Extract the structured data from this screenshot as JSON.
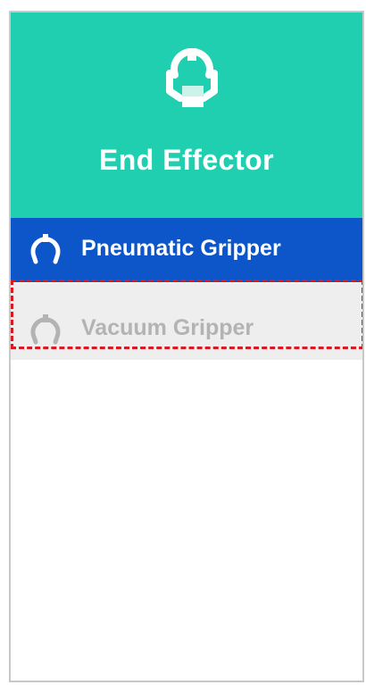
{
  "header": {
    "title": "End Effector",
    "icon": "end-effector-icon",
    "background_color": "#1fcfb0"
  },
  "menu": {
    "items": [
      {
        "label": "Pneumatic Gripper",
        "icon": "gripper-icon",
        "state": "selected",
        "background_color": "#0d56c9",
        "text_color": "#ffffff"
      },
      {
        "label": "Vacuum Gripper",
        "icon": "gripper-icon",
        "state": "disabled",
        "background_color": "#eeeeee",
        "text_color": "#b3b3b3"
      }
    ]
  },
  "highlight": {
    "style": "dashed",
    "color": "#d81b22",
    "target": "Vacuum Gripper"
  }
}
